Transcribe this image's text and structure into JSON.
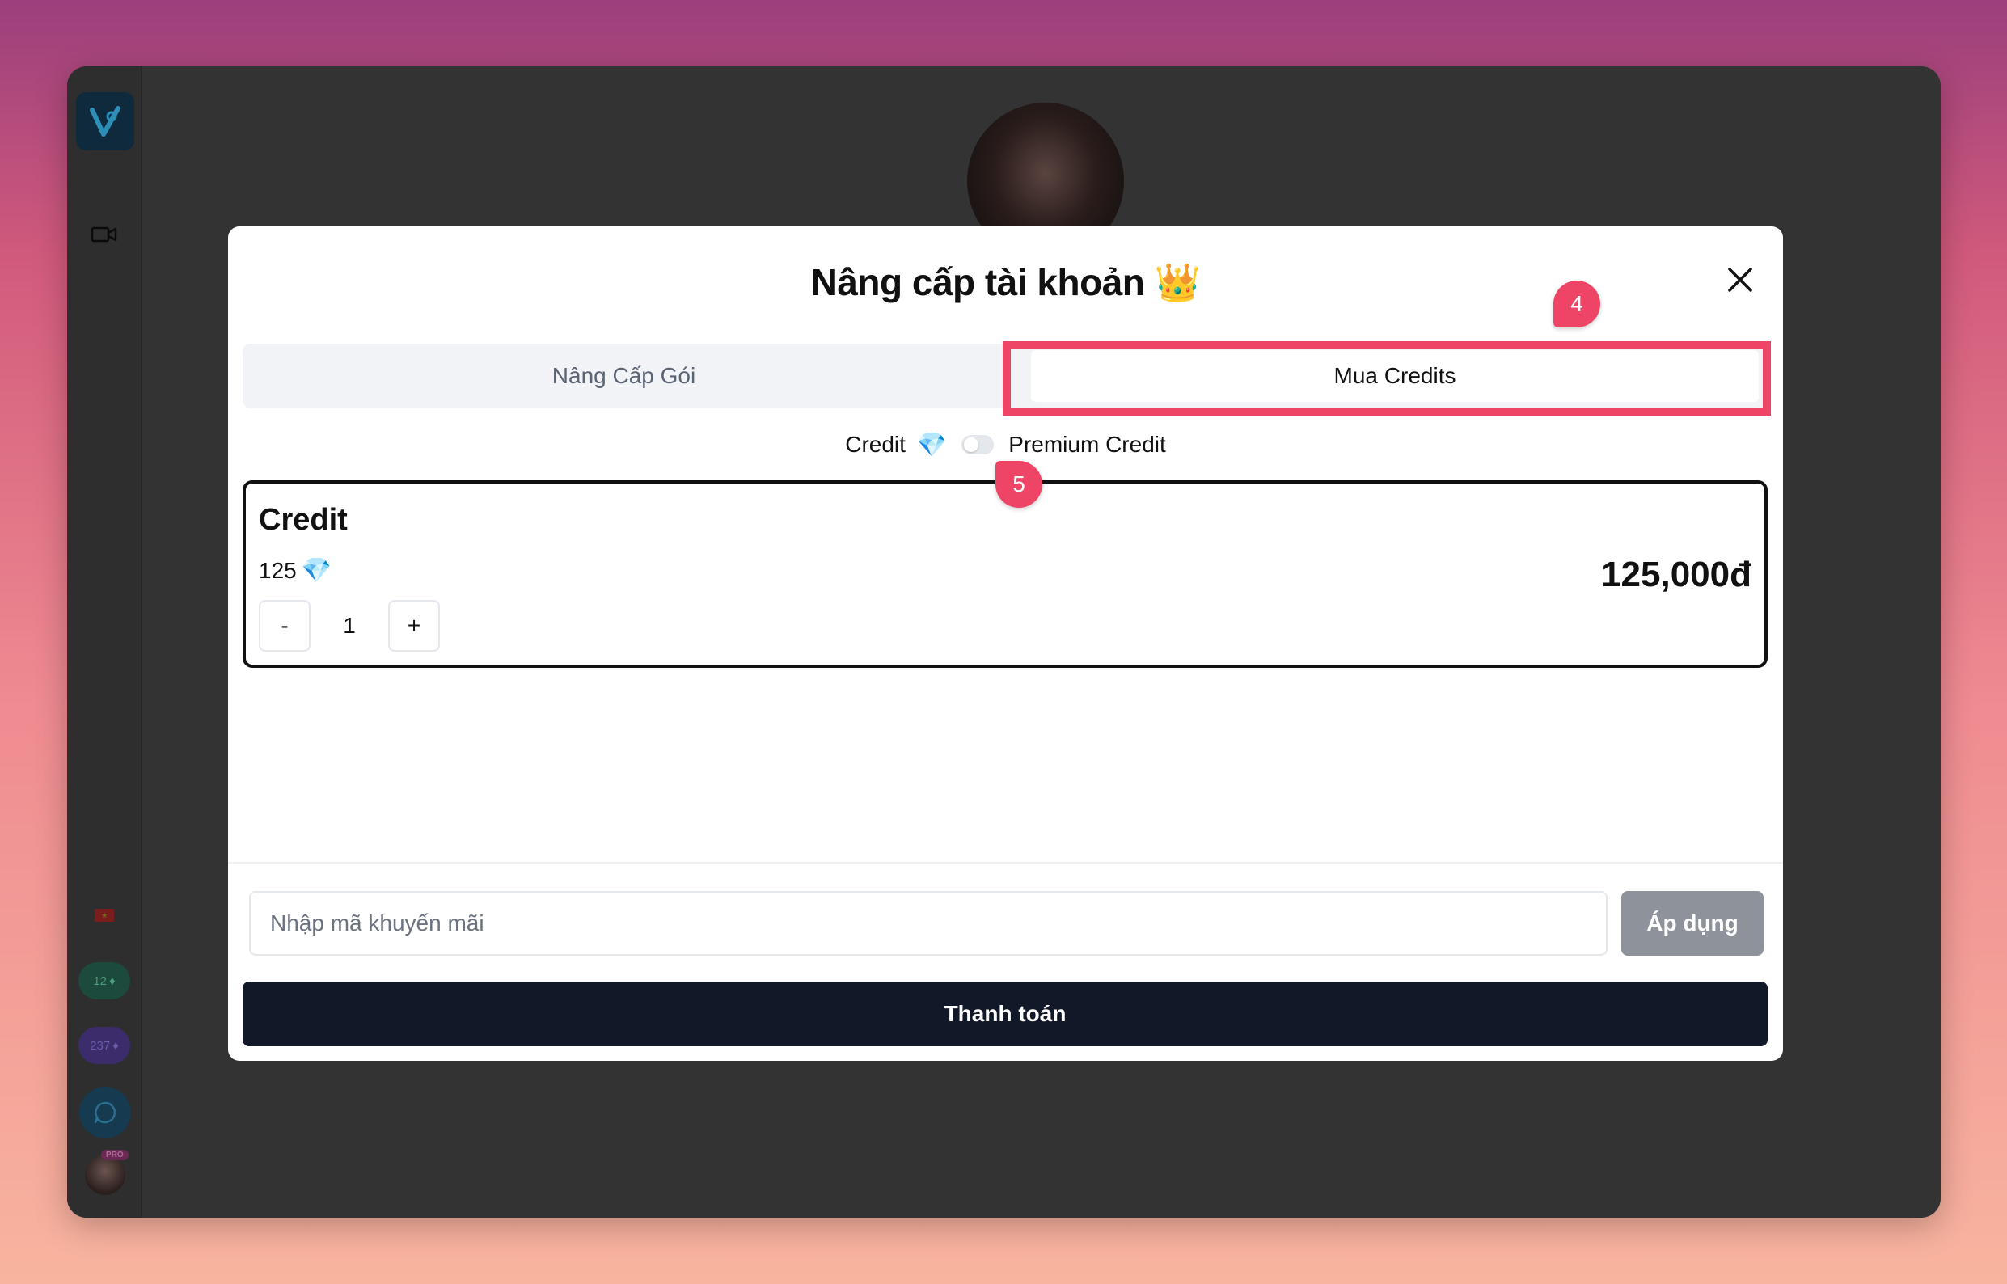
{
  "sidebar": {
    "logo_letter": "V",
    "credit_count": "12",
    "premium_count": "237",
    "pro_badge": "PRO"
  },
  "modal": {
    "title": "Nâng cấp tài khoản 👑",
    "tabs": [
      {
        "label": "Nâng Cấp Gói",
        "active": false
      },
      {
        "label": "Mua Credits",
        "active": true
      }
    ],
    "toggle": {
      "left_label": "Credit",
      "gem": "💎",
      "right_label": "Premium Credit",
      "checked": false
    },
    "product": {
      "name": "Credit",
      "amount": "125",
      "price": "125,000đ",
      "quantity": "1",
      "minus_label": "-",
      "plus_label": "+"
    },
    "promo": {
      "placeholder": "Nhập mã khuyến mãi",
      "value": "",
      "apply_label": "Áp dụng"
    },
    "pay_label": "Thanh toán"
  },
  "annotations": {
    "step_4": "4",
    "step_5": "5",
    "highlight_color": "#ee4466"
  },
  "colors": {
    "modal_bg": "#ffffff",
    "pay_button": "#111827",
    "apply_button": "#8e939b",
    "gem": "#5fc7e6"
  }
}
